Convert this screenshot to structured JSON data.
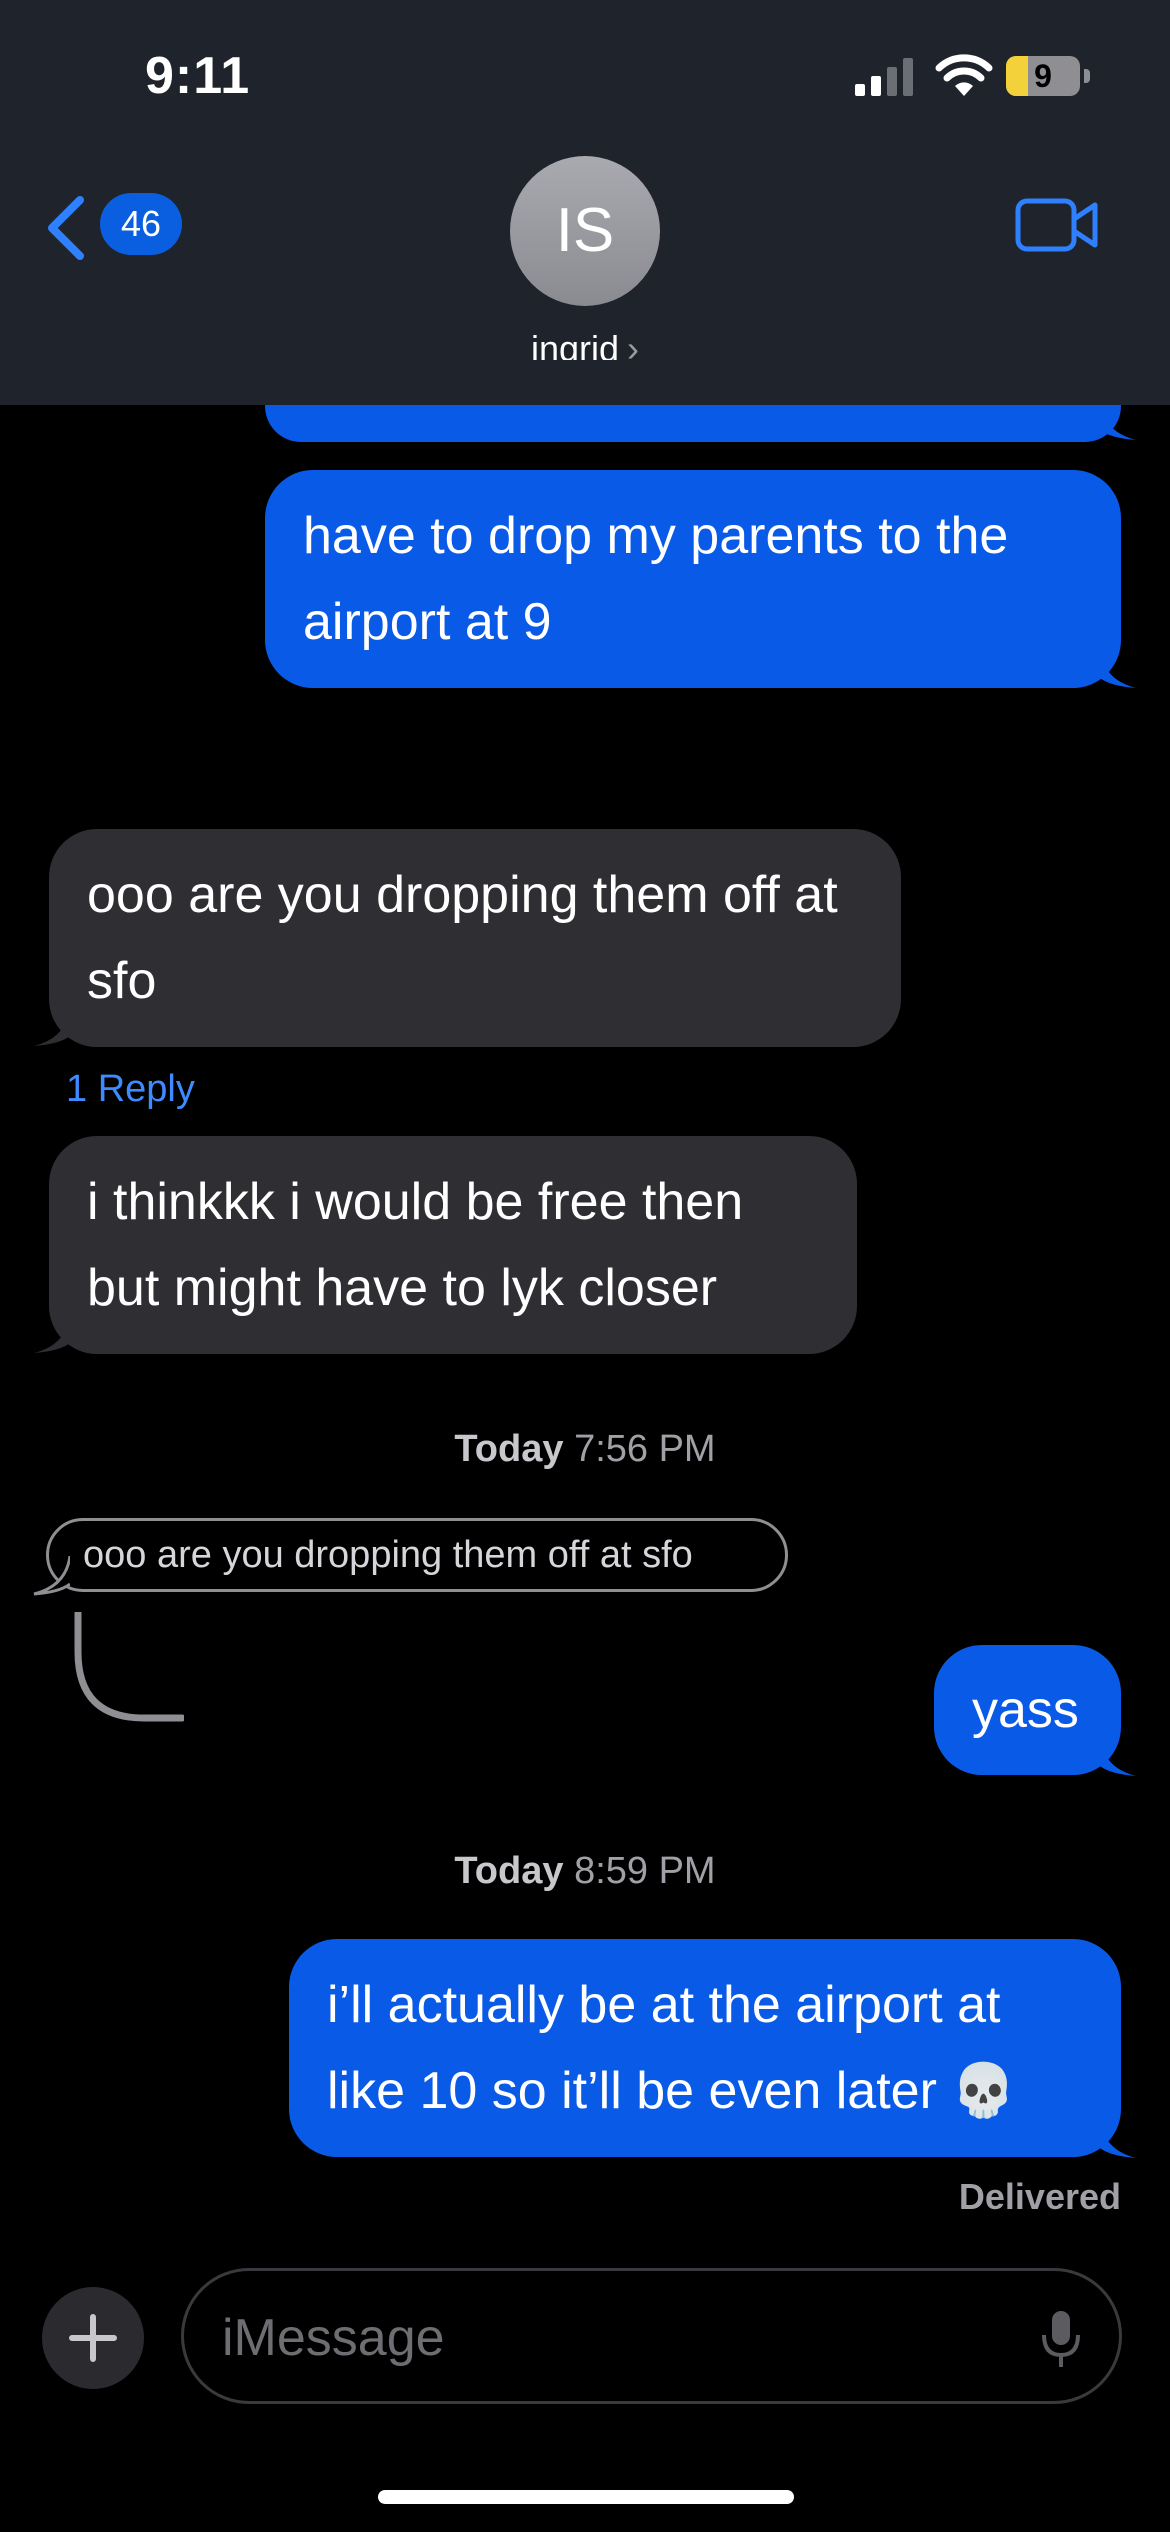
{
  "status_bar": {
    "time": "9:11",
    "battery": "9",
    "battery_level": 0.09
  },
  "header": {
    "back_count": "46",
    "avatar_initials": "IS",
    "contact_name": "ingrid",
    "name_chevron": "›"
  },
  "messages": {
    "m1": "have to drop my parents to the airport at 9",
    "m2": "ooo are you dropping them off at sfo",
    "reply_count": "1 Reply",
    "m3": "i thinkkk i would be free then but might have to lyk closer",
    "ts1_day": "Today",
    "ts1_time": "7:56 PM",
    "quoted": "ooo are you dropping them off at sfo",
    "m4": "yass",
    "ts2_day": "Today",
    "ts2_time": "8:59 PM",
    "m5": "i’ll actually be at the airport at like 10 so it’ll be even later 💀",
    "delivered": "Delivered"
  },
  "composer": {
    "placeholder": "iMessage",
    "plus": "+"
  },
  "colors": {
    "sent_bubble": "#0a5ae8",
    "received_bubble": "#2f2f33",
    "link": "#3d8bff"
  }
}
